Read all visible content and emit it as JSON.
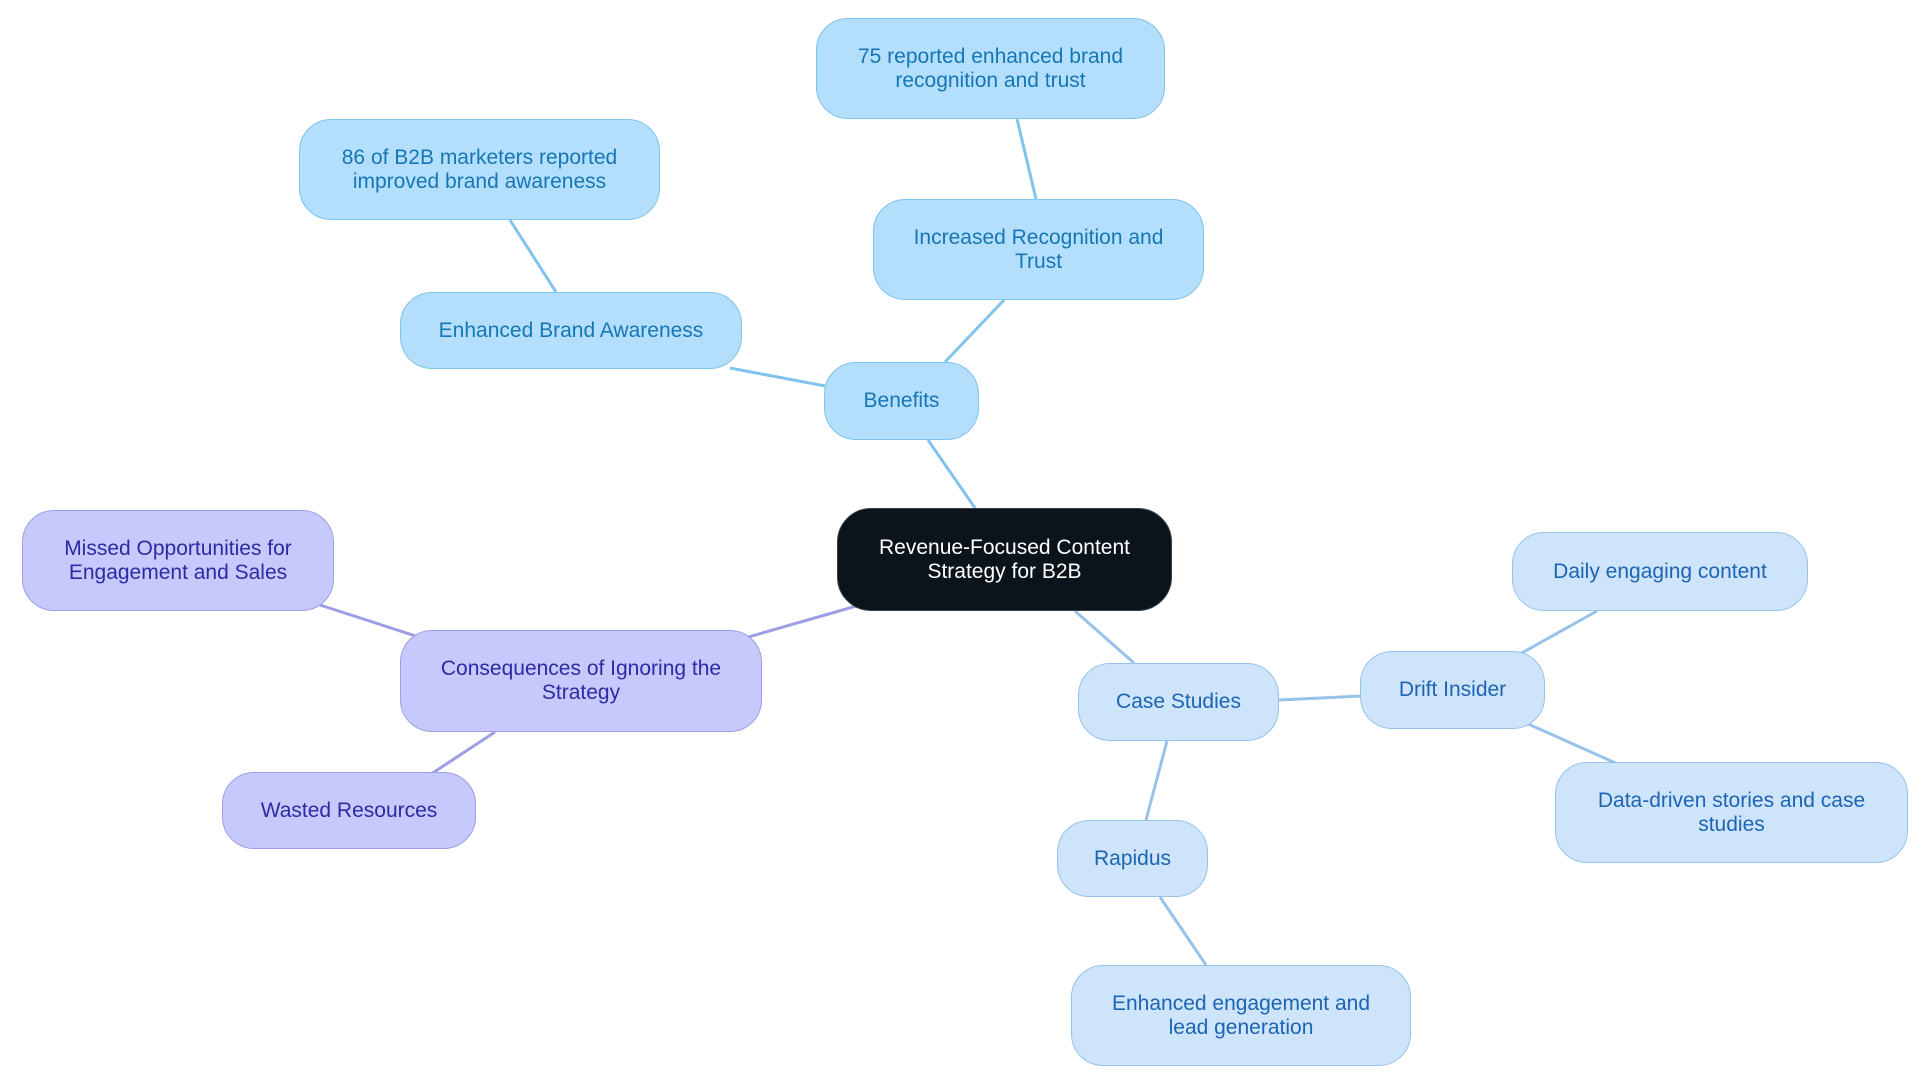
{
  "diagram": {
    "type": "mindmap",
    "root": {
      "id": "root",
      "label": "Revenue-Focused Content Strategy for B2B"
    },
    "nodes": [
      {
        "id": "benefits",
        "label": "Benefits",
        "parent": "root",
        "branch": "benefits"
      },
      {
        "id": "brand-awareness",
        "label": "Enhanced Brand Awareness",
        "parent": "benefits",
        "branch": "benefits"
      },
      {
        "id": "stat-86",
        "label": "86 of B2B marketers reported improved brand awareness",
        "parent": "brand-awareness",
        "branch": "benefits"
      },
      {
        "id": "recognition-trust",
        "label": "Increased Recognition and Trust",
        "parent": "benefits",
        "branch": "benefits"
      },
      {
        "id": "stat-75",
        "label": "75 reported enhanced brand recognition and trust",
        "parent": "recognition-trust",
        "branch": "benefits"
      },
      {
        "id": "consequences",
        "label": "Consequences of Ignoring the Strategy",
        "parent": "root",
        "branch": "consequences"
      },
      {
        "id": "missed-opps",
        "label": "Missed Opportunities for Engagement and Sales",
        "parent": "consequences",
        "branch": "consequences"
      },
      {
        "id": "wasted",
        "label": "Wasted Resources",
        "parent": "consequences",
        "branch": "consequences"
      },
      {
        "id": "case-studies",
        "label": "Case Studies",
        "parent": "root",
        "branch": "case-studies"
      },
      {
        "id": "drift",
        "label": "Drift Insider",
        "parent": "case-studies",
        "branch": "case-studies"
      },
      {
        "id": "daily",
        "label": "Daily engaging content",
        "parent": "drift",
        "branch": "case-studies"
      },
      {
        "id": "data-driven",
        "label": "Data-driven stories and case studies",
        "parent": "drift",
        "branch": "case-studies"
      },
      {
        "id": "rapidus",
        "label": "Rapidus",
        "parent": "case-studies",
        "branch": "case-studies"
      },
      {
        "id": "engagement",
        "label": "Enhanced engagement and lead generation",
        "parent": "rapidus",
        "branch": "case-studies"
      }
    ],
    "colors": {
      "root_fill": "#0b131b",
      "benefits_fill": "#b3dffc",
      "benefits_edge": "#80c3ec",
      "case_studies_fill": "#cde4fa",
      "case_studies_edge": "#97c3ea",
      "consequences_fill": "#c7c9fc",
      "consequences_edge": "#9d9fe6"
    }
  }
}
